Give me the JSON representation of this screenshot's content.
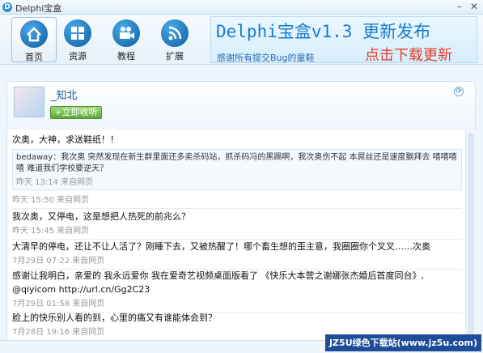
{
  "window": {
    "title": "Delphi宝盒",
    "minimize": "–",
    "close": "✕"
  },
  "toolbar": {
    "items": [
      {
        "label": "首页",
        "icon": "home-icon"
      },
      {
        "label": "资源",
        "icon": "grid-icon"
      },
      {
        "label": "教程",
        "icon": "video-icon"
      },
      {
        "label": "扩展",
        "icon": "wifi-icon"
      }
    ]
  },
  "banner": {
    "title": "Delphi宝盒v1.3 更新发布",
    "subtitle": "感谢所有提交Bug的童鞋",
    "cta": "点击下载更新"
  },
  "profile": {
    "name": "_知北",
    "collect_label": "+立即收听"
  },
  "feed": [
    {
      "text": "次奥，大神，求送鞋纸！！",
      "repost": {
        "text": "bedaway：我次奥 突然发现在新生群里面还多卖杀码站，抓杀码冯的黑踢啊，我次奥伤不起 本屌丝还是速度飘拜去 嘻嘻嘻嘻 难道我们学校要逆天？",
        "meta": "昨天 13:14 来自网页"
      },
      "meta": "昨天 15:50 来自网页"
    },
    {
      "text": "我次奥，又停电，这是想把人热死的前兆么？",
      "meta": "昨天 15:45 来自网页"
    },
    {
      "text": "大清早的停电，还让不让人活了？刚睡下去，又被热醒了！哪个畜生想的歪主意，我圈圈你个叉叉……次奥",
      "meta": "7月29日 07:22 来自网页"
    },
    {
      "text": "感谢让我明白，亲爱的 我永远爱你 我在爱奇艺视频桌面版看了 《快乐大本营之谢娜张杰婚后首度同台》, @qiyicom http://url.cn/Gg2C23",
      "meta": "7月29日 01:58 来自网页"
    },
    {
      "text": "脸上的快乐别人看的到，心里的痛又有谁能体会到？",
      "meta": "7月28日 19:16 来自网页"
    }
  ],
  "watermark": "JZ5U绿色下载站(www.jz5u.com)"
}
